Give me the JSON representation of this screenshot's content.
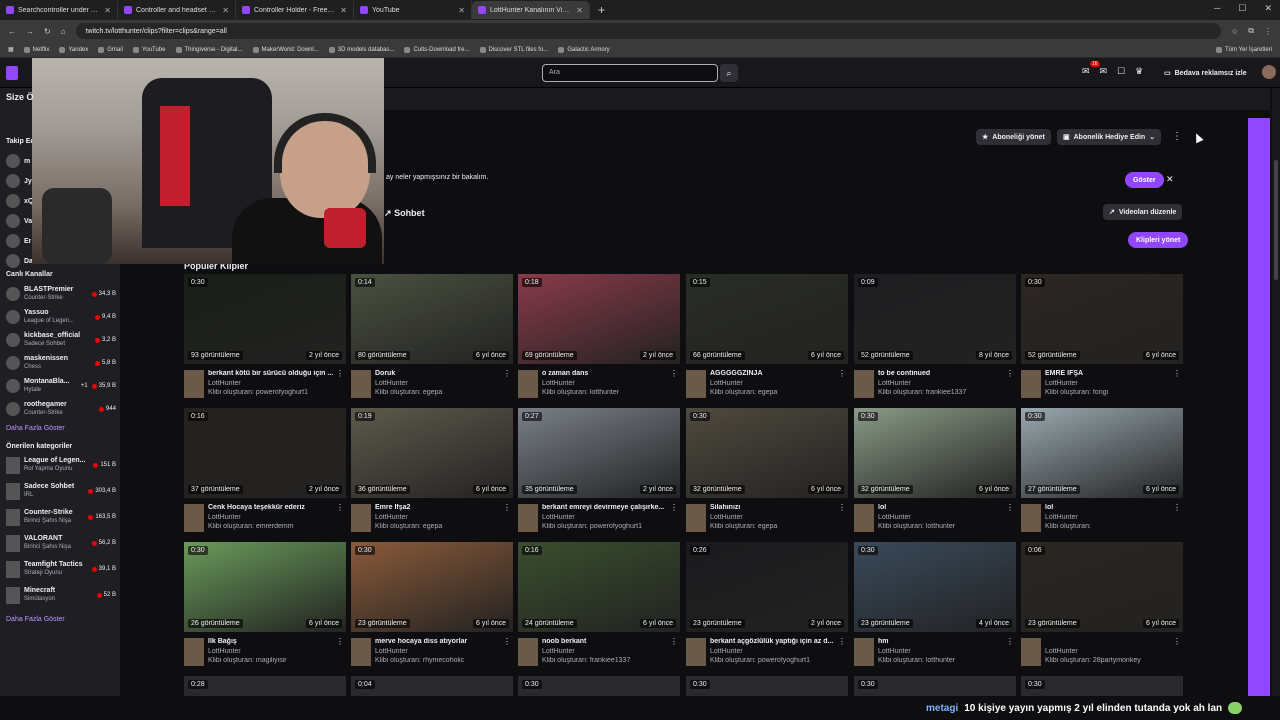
{
  "browser": {
    "tabs": [
      {
        "title": "Searchcontroller under desk - ",
        "active": false
      },
      {
        "title": "Controller and headset holder",
        "active": false
      },
      {
        "title": "Controller Holder - Free 3D Pri",
        "active": false
      },
      {
        "title": "YouTube",
        "active": false
      },
      {
        "title": "LottHunter Kanalının Videoları",
        "active": true
      }
    ],
    "url": "twitch.tv/lotthunter/clips?filter=clips&range=all",
    "bookmarks": [
      "Netflix",
      "Yandex",
      "Gmail",
      "YouTube",
      "Thingiverse - Digital...",
      "MakerWorld: Downl...",
      "3D models databas...",
      "Cults-Download fre...",
      "Discover STL files fo...",
      "Galactic Armory"
    ],
    "bookmarks_right": "Tüm Yer İşaretleri"
  },
  "topnav": {
    "search_placeholder": "Ara",
    "notif_count": "16",
    "adfree_label": "Bedava reklamsız izle"
  },
  "sidebar": {
    "size_label": "Size Ö",
    "follow_label": "Takip Ed",
    "live_heading": "Canlı Kanallar",
    "live_channels": [
      {
        "name": "BLASTPremier",
        "sub": "Counter-Strike",
        "viewers": "34,3 B"
      },
      {
        "name": "Yassuo",
        "sub": "League of Legen...",
        "viewers": "9,4 B"
      },
      {
        "name": "kickbase_official",
        "sub": "Sadece Sohbet",
        "viewers": "3,2 B"
      },
      {
        "name": "maskenissen",
        "sub": "Chess",
        "viewers": "5,8 B"
      },
      {
        "name": "MontanaBla...",
        "extra": "+1",
        "sub": "Hytale",
        "viewers": "35,9 B"
      },
      {
        "name": "roothegamer",
        "sub": "Counter-Strike",
        "viewers": "944"
      }
    ],
    "more_label": "Daha Fazla Göster",
    "rec_heading": "Önerilen kategoriler",
    "categories": [
      {
        "name": "League of Legen...",
        "sub": "Rol Yapma Oyunu",
        "viewers": "151 B"
      },
      {
        "name": "Sadece Sohbet",
        "sub": "IRL",
        "viewers": "303,4 B"
      },
      {
        "name": "Counter-Strike",
        "sub": "Birinci Şahıs Nişa",
        "viewers": "163,5 B"
      },
      {
        "name": "VALORANT",
        "sub": "Birinci Şahıs Nişa",
        "viewers": "56,2 B"
      },
      {
        "name": "Teamfight Tactics",
        "sub": "Strateji Oyunu",
        "viewers": "39,1 B"
      },
      {
        "name": "Minecraft",
        "sub": "Simülasyon",
        "viewers": "52 B"
      }
    ],
    "more_label_2": "Daha Fazla Göster",
    "collapsed_items": [
      "m",
      "Jy",
      "xQ",
      "Va",
      "Er",
      "Daha Fa"
    ]
  },
  "header": {
    "sub_manage": "Aboneliği yönet",
    "gift_sub": "Abonelik Hediye Edin",
    "announcement": "ay neler yapmışsınız bir bakalım.",
    "show_btn": "Göster",
    "chat_label": "Sohbet",
    "edit_videos": "Videoları düzenle",
    "clips_btn": "Klipleri yönet",
    "popular_heading": "Popüler Klipler"
  },
  "clips": [
    {
      "dur": "0:30",
      "views": "93 görüntüleme",
      "ago": "2 yıl önce",
      "title": "berkant kötü bir sürücü olduğu için ...",
      "channel": "LottHunter",
      "by": "Klibi oluşturan: powerofyoghurt1",
      "bg": "#1a1d18"
    },
    {
      "dur": "0:14",
      "views": "80 görüntüleme",
      "ago": "6 yıl önce",
      "title": "Doruk",
      "channel": "LottHunter",
      "by": "Klibi oluşturan: egepa",
      "bg": "#4c5040"
    },
    {
      "dur": "0:18",
      "views": "69 görüntüleme",
      "ago": "2 yıl önce",
      "title": "o zaman dans",
      "channel": "LottHunter",
      "by": "Klibi oluşturan: lotthunter",
      "bg": "#8a3a4a"
    },
    {
      "dur": "0:15",
      "views": "66 görüntüleme",
      "ago": "6 yıl önce",
      "title": "AĞĞĞĞĞZINJA",
      "channel": "LottHunter",
      "by": "Klibi oluşturan: egepa",
      "bg": "#2a2c26"
    },
    {
      "dur": "0:09",
      "views": "52 görüntüleme",
      "ago": "8 yıl önce",
      "title": "to be continued",
      "channel": "LottHunter",
      "by": "Klibi oluşturan: frankiee1337",
      "bg": "#1e1e20"
    },
    {
      "dur": "0:30",
      "views": "52 görüntüleme",
      "ago": "6 yıl önce",
      "title": "EMRE İFŞA",
      "channel": "LottHunter",
      "by": "Klibi oluşturan: fongi",
      "bg": "#2b2622"
    },
    {
      "dur": "0:16",
      "views": "37 görüntüleme",
      "ago": "2 yıl önce",
      "title": "Cenk Hocaya teşekkür ederiz",
      "channel": "LottHunter",
      "by": "Klibi oluşturan: emrerdemm",
      "bg": "#26221f"
    },
    {
      "dur": "0:19",
      "views": "36 görüntüleme",
      "ago": "6 yıl önce",
      "title": "Emre İfşa2",
      "channel": "LottHunter",
      "by": "Klibi oluşturan: egepa",
      "bg": "#5d5a4c"
    },
    {
      "dur": "0:27",
      "views": "35 görüntüleme",
      "ago": "2 yıl önce",
      "title": "berkant emreyi devirmeye çalışırke...",
      "channel": "LottHunter",
      "by": "Klibi oluşturan: powerofyoghurt1",
      "bg": "#7a8088"
    },
    {
      "dur": "0:30",
      "views": "32 görüntüleme",
      "ago": "6 yıl önce",
      "title": "Silahınızı",
      "channel": "LottHunter",
      "by": "Klibi oluşturan: egepa",
      "bg": "#4e4a3e"
    },
    {
      "dur": "0:30",
      "views": "32 görüntüleme",
      "ago": "6 yıl önce",
      "title": "lol",
      "channel": "LottHunter",
      "by": "Klibi oluşturan: lotthunter",
      "bg": "#8a9a86"
    },
    {
      "dur": "0:30",
      "views": "27 görüntüleme",
      "ago": "6 yıl önce",
      "title": "lol",
      "channel": "LottHunter",
      "by": "Klibi oluşturan:",
      "bg": "#9aa8ae"
    },
    {
      "dur": "0:30",
      "views": "26 görüntüleme",
      "ago": "6 yıl önce",
      "title": "İlk Bağış",
      "channel": "LottHunter",
      "by": "Klibi oluşturan: magiliyisir",
      "bg": "#6a9a5a"
    },
    {
      "dur": "0:30",
      "views": "23 görüntüleme",
      "ago": "6 yıl önce",
      "title": "merve hocaya diss atıyorlar",
      "channel": "LottHunter",
      "by": "Klibi oluşturan: rhymecoholic",
      "bg": "#8a5a3a"
    },
    {
      "dur": "0:16",
      "views": "24 görüntüleme",
      "ago": "6 yıl önce",
      "title": "noob berkant",
      "channel": "LottHunter",
      "by": "Klibi oluşturan: frankiee1337",
      "bg": "#3a4e2e"
    },
    {
      "dur": "0:26",
      "views": "23 görüntüleme",
      "ago": "2 yıl önce",
      "title": "berkant açgözlülük yaptığı için az d...",
      "channel": "LottHunter",
      "by": "Klibi oluşturan: powerofyoghurt1",
      "bg": "#1a1a1c"
    },
    {
      "dur": "0:30",
      "views": "23 görüntüleme",
      "ago": "4 yıl önce",
      "title": "hm",
      "channel": "LottHunter",
      "by": "Klibi oluşturan: lotthunter",
      "bg": "#3a4a5a"
    },
    {
      "dur": "0:06",
      "views": "23 görüntüleme",
      "ago": "6 yıl önce",
      "title": "",
      "channel": "LottHunter",
      "by": "Klibi oluşturan: 28partymonkey",
      "bg": "#2a2622"
    }
  ],
  "partial_durs": [
    "0:28",
    "0:04",
    "0:30",
    "0:30",
    "0:30",
    "0:30"
  ],
  "chat": {
    "user": "metagi",
    "message": "10 kişiye yayın yapmış 2 yıl elinden tutanda yok ah lan"
  },
  "colors": {
    "accent": "#9147ff",
    "live": "#eb0400"
  }
}
